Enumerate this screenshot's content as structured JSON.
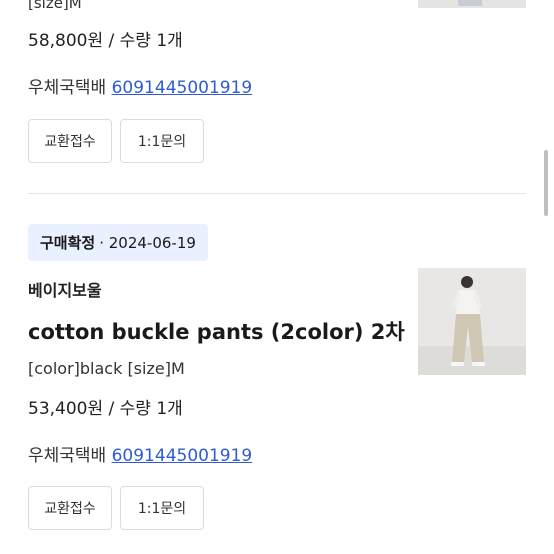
{
  "order_top": {
    "options_partial": "[size]M",
    "price_qty": "58,800원 / 수량 1개",
    "carrier": "우체국택배",
    "tracking": "6091445001919",
    "exchange_label": "교환접수",
    "inquiry_label": "1:1문의"
  },
  "order_bottom": {
    "status": "구매확정",
    "date": "· 2024-06-19",
    "brand": "베이지보울",
    "title": "cotton buckle pants (2color) 2차",
    "options": "[color]black [size]M",
    "price_qty": "53,400원 / 수량 1개",
    "carrier": "우체국택배",
    "tracking": "6091445001919",
    "exchange_label": "교환접수",
    "inquiry_label": "1:1문의"
  },
  "colors": {
    "link": "#2f5bd3",
    "badge_bg": "#e9f0ff"
  }
}
